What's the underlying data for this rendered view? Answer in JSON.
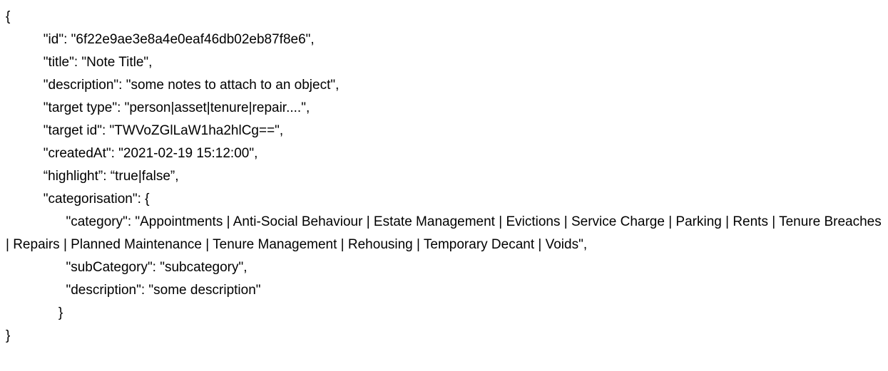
{
  "document": {
    "type": "json-snippet",
    "text_color": "#000000",
    "background_color": "#ffffff",
    "lines": [
      {
        "indent": "",
        "text": "{"
      },
      {
        "indent": "          ",
        "text": "\"id\": \"6f22e9ae3e8a4e0eaf46db02eb87f8e6\","
      },
      {
        "indent": "          ",
        "text": "\"title\": \"Note Title\","
      },
      {
        "indent": "          ",
        "text": "\"description\": \"some notes to attach to an object\","
      },
      {
        "indent": "          ",
        "text": "\"target type\": \"person|asset|tenure|repair....\","
      },
      {
        "indent": "          ",
        "text": "\"target id\": \"TWVoZGlLaW1ha2hlCg==\","
      },
      {
        "indent": "          ",
        "text": "\"createdAt\": \"2021-02-19 15:12:00\","
      },
      {
        "indent": "          ",
        "text": "“highlight”: “true|false”,"
      },
      {
        "indent": "          ",
        "text": "\"categorisation\": {"
      },
      {
        "indent": "                ",
        "text": "\"category\": \"Appointments | Anti-Social Behaviour | Estate Management | Evictions | Service Charge | Parking | Rents | Tenure Breaches | Repairs | Planned Maintenance | Tenure Management | Rehousing | Temporary Decant | Voids\","
      },
      {
        "indent": "                ",
        "text": "\"subCategory\": \"subcategory\","
      },
      {
        "indent": "                ",
        "text": "\"description\": \"some description\""
      },
      {
        "indent": "              ",
        "text": "}"
      },
      {
        "indent": "",
        "text": "}"
      }
    ],
    "fields": {
      "id": "6f22e9ae3e8a4e0eaf46db02eb87f8e6",
      "title": "Note Title",
      "description": "some notes to attach to an object",
      "target type": "person|asset|tenure|repair....",
      "target id": "TWVoZGlLaW1ha2hlCg==",
      "createdAt": "2021-02-19 15:12:00",
      "highlight": "true|false",
      "categorisation": {
        "category": "Appointments | Anti-Social Behaviour | Estate Management | Evictions | Service Charge | Parking | Rents | Tenure Breaches | Repairs | Planned Maintenance | Tenure Management | Rehousing | Temporary Decant | Voids",
        "subCategory": "subcategory",
        "description": "some description"
      }
    },
    "category_options": [
      "Appointments",
      "Anti-Social Behaviour",
      "Estate Management",
      "Evictions",
      "Service Charge",
      "Parking",
      "Rents",
      "Tenure Breaches",
      "Repairs",
      "Planned Maintenance",
      "Tenure Management",
      "Rehousing",
      "Temporary Decant",
      "Voids"
    ],
    "target_type_options": [
      "person",
      "asset",
      "tenure",
      "repair...."
    ],
    "highlight_options": [
      "true",
      "false"
    ]
  }
}
